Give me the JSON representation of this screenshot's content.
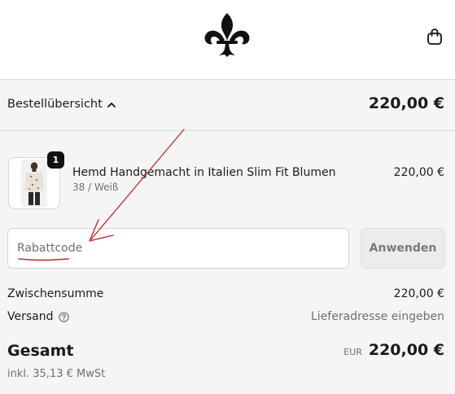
{
  "header": {
    "logo_icon": "fleur-de-lis-icon",
    "cart_icon": "shopping-bag-icon"
  },
  "summary": {
    "toggle_label": "Bestellübersicht",
    "toggle_icon": "chevron-up-icon",
    "total": "220,00 €"
  },
  "cart_item": {
    "quantity": "1",
    "name": "Hemd Handgemacht in Italien Slim Fit Blumen",
    "variant": "38 / Weiß",
    "price": "220,00 €"
  },
  "discount": {
    "placeholder": "Rabattcode",
    "value": "",
    "apply_label": "Anwenden"
  },
  "totals": {
    "subtotal_label": "Zwischensumme",
    "subtotal_value": "220,00 €",
    "shipping_label": "Versand",
    "shipping_help_icon": "question-circle-icon",
    "shipping_value": "Lieferadresse eingeben",
    "total_label": "Gesamt",
    "currency": "EUR",
    "total_value": "220,00 €",
    "tax_note": "inkl. 35,13 € MwSt"
  },
  "colors": {
    "accent_annotation": "#c0282d",
    "background": "#f5f5f5"
  }
}
